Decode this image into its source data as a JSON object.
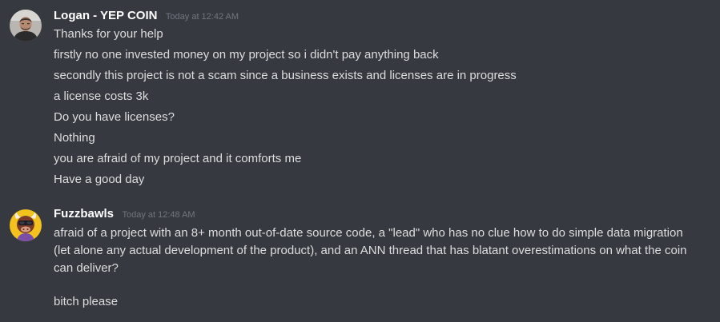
{
  "messages": [
    {
      "author": "Logan - YEP COIN",
      "timestamp": "Today at 12:42 AM",
      "avatar_icon": "user-photo-avatar",
      "lines": [
        "Thanks for your help",
        "firstly no one invested money on my project so i didn't pay anything back",
        "secondly this project is not a scam since a business exists and licenses are in progress",
        "a license costs 3k",
        "Do you have licenses?",
        "Nothing",
        "you are afraid of my project and it comforts me",
        "Have a good day"
      ]
    },
    {
      "author": "Fuzzbawls",
      "timestamp": "Today at 12:48 AM",
      "avatar_icon": "bull-mascot-avatar",
      "body": "afraid of a project with an 8+ month out-of-date source code, a \"lead\" who has no clue how to do simple data migration (let alone any actual development of the product), and an ANN thread that has blatant overestimations on what the coin can deliver?",
      "lines": [
        "bitch please"
      ]
    }
  ],
  "colors": {
    "background": "#36393f",
    "username": "#ffffff",
    "message_text": "#dcddde",
    "timestamp": "#72767d"
  }
}
